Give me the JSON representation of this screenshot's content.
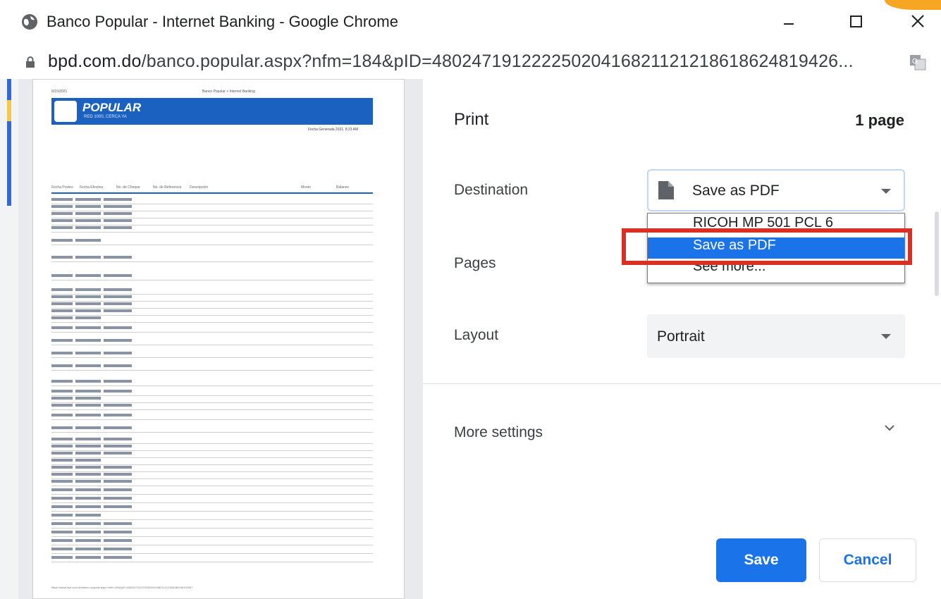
{
  "window": {
    "title": "Banco Popular - Internet Banking - Google Chrome",
    "icon": "globe-icon",
    "controls": [
      "minimize-icon",
      "maximize-icon",
      "close-icon"
    ]
  },
  "address_bar": {
    "url_host": "bpd.com.do",
    "url_path": "/banco.popular.aspx?nfm=184&pID=48024719122225020416821121218618624819426..."
  },
  "preview": {
    "header_left": "6/15/2021",
    "header_center": "Banco Popular > Internet Banking",
    "brand": "POPULAR",
    "brand_sub": "RED 1000, CERCA YA",
    "date_right": "Fecha Generada 2021, 8:23 AM",
    "columns": [
      "Fecha Posteo",
      "Fecha Efectiva",
      "No. de Cheque",
      "No. de Referencia",
      "Descripción",
      "Monto",
      "Balance"
    ],
    "footer": "https://www.bpd.com.do/banco.popular.aspx?nfm=184&pID=480247191222250204168211212186186248194267"
  },
  "print_panel": {
    "title": "Print",
    "page_count": "1 page",
    "destination_label": "Destination",
    "destination_value": "Save as PDF",
    "destination_options": [
      "RICOH MP 501 PCL 6",
      "Save as PDF",
      "See more..."
    ],
    "selected_option_index": 1,
    "pages_label": "Pages",
    "layout_label": "Layout",
    "layout_value": "Portrait",
    "more_settings_label": "More settings",
    "save_label": "Save",
    "cancel_label": "Cancel"
  },
  "colors": {
    "accent": "#1a73e8",
    "highlight": "#d93025",
    "brand_blue": "#1b62c0"
  }
}
